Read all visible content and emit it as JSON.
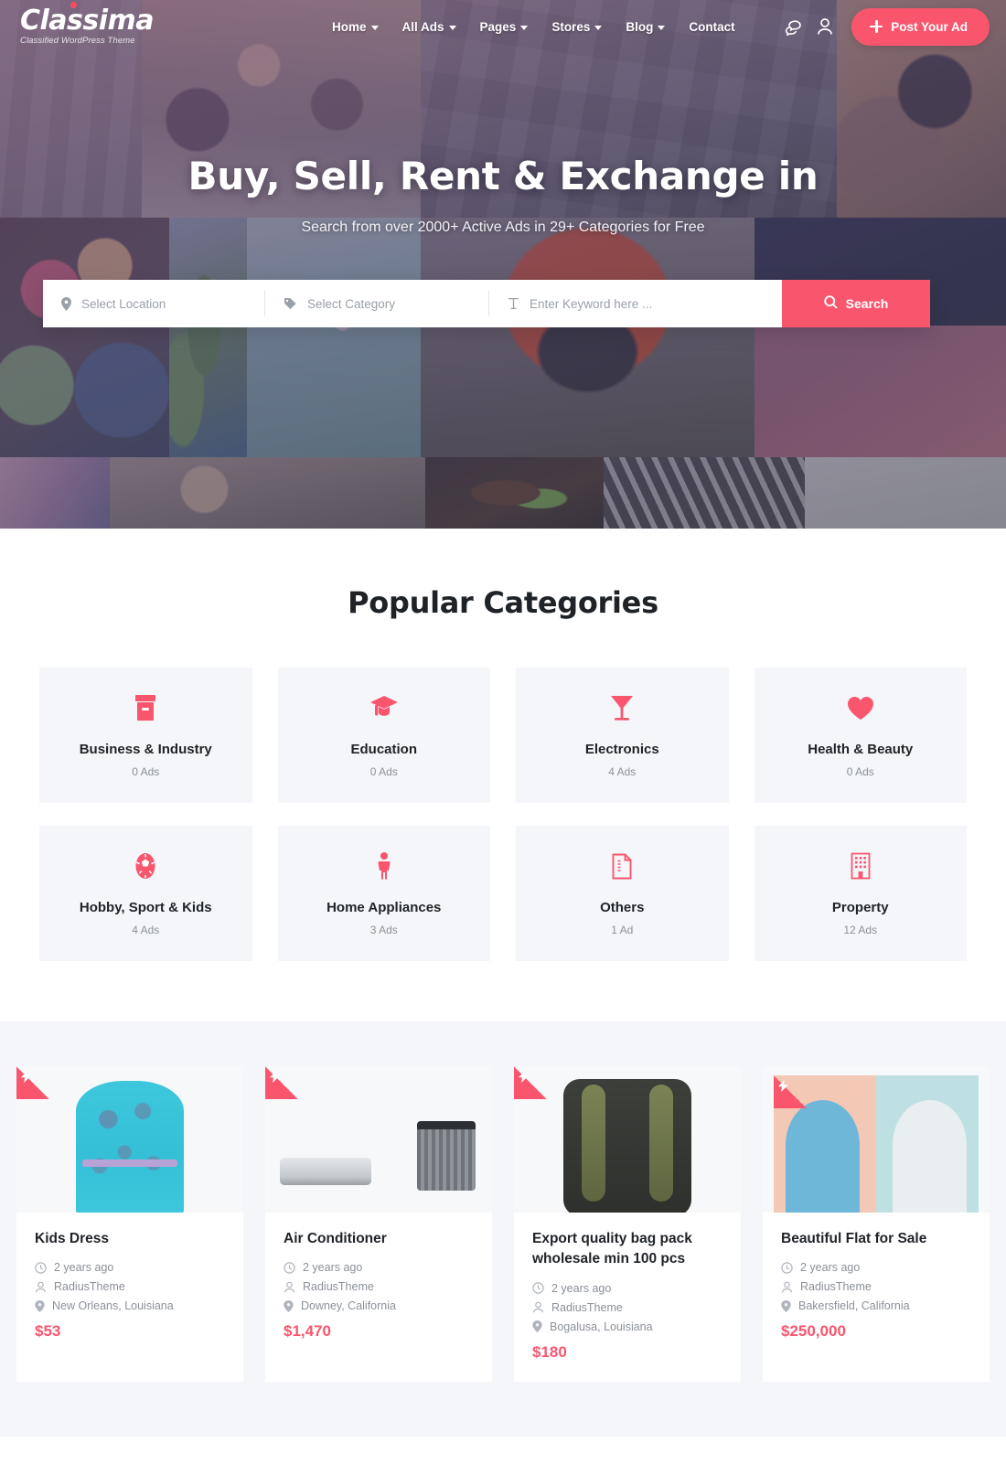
{
  "header": {
    "logo": {
      "name": "Classima",
      "tagline": "Classified WordPress Theme"
    },
    "nav": [
      {
        "label": "Home",
        "has_dropdown": true
      },
      {
        "label": "All Ads",
        "has_dropdown": true
      },
      {
        "label": "Pages",
        "has_dropdown": true
      },
      {
        "label": "Stores",
        "has_dropdown": true
      },
      {
        "label": "Blog",
        "has_dropdown": true
      },
      {
        "label": "Contact",
        "has_dropdown": false
      }
    ],
    "icons": {
      "chat": "chat-bubbles-icon",
      "account": "user-account-icon"
    },
    "post_ad_label": "Post Your Ad"
  },
  "hero": {
    "title": "Buy, Sell, Rent & Exchange in",
    "subtitle": "Search from over 2000+ Active Ads in 29+ Categories for Free"
  },
  "search": {
    "location_placeholder": "Select Location",
    "category_placeholder": "Select Category",
    "keyword_placeholder": "Enter Keyword here ...",
    "button_label": "Search"
  },
  "categories_section": {
    "title": "Popular Categories",
    "items": [
      {
        "name": "Business & Industry",
        "count": "0 Ads",
        "icon": "box-icon"
      },
      {
        "name": "Education",
        "count": "0 Ads",
        "icon": "graduation-cap-icon"
      },
      {
        "name": "Electronics",
        "count": "4 Ads",
        "icon": "cocktail-glass-icon"
      },
      {
        "name": "Health & Beauty",
        "count": "0 Ads",
        "icon": "heart-icon"
      },
      {
        "name": "Hobby, Sport & Kids",
        "count": "4 Ads",
        "icon": "football-icon"
      },
      {
        "name": "Home Appliances",
        "count": "3 Ads",
        "icon": "person-icon"
      },
      {
        "name": "Others",
        "count": "1 Ad",
        "icon": "document-icon"
      },
      {
        "name": "Property",
        "count": "12 Ads",
        "icon": "building-icon"
      }
    ]
  },
  "ads_section": {
    "items": [
      {
        "title": "Kids Dress",
        "time": "2 years ago",
        "author": "RadiusTheme",
        "location": "New Orleans, Louisiana",
        "price": "$53",
        "badge": "urgent-bolt-icon",
        "image": "kids-dress-photo"
      },
      {
        "title": "Air Conditioner",
        "time": "2 years ago",
        "author": "RadiusTheme",
        "location": "Downey, California",
        "price": "$1,470",
        "badge": "urgent-bolt-icon",
        "image": "air-conditioner-photo"
      },
      {
        "title": "Export quality bag pack wholesale min 100 pcs",
        "time": "2 years ago",
        "author": "RadiusTheme",
        "location": "Bogalusa, Louisiana",
        "price": "$180",
        "badge": "urgent-bolt-icon",
        "image": "backpack-photo"
      },
      {
        "title": "Beautiful Flat for Sale",
        "time": "2 years ago",
        "author": "RadiusTheme",
        "location": "Bakersfield, California",
        "price": "$250,000",
        "badge": "urgent-bolt-icon",
        "image": "flat-doors-photo"
      }
    ]
  },
  "colors": {
    "accent": "#f9566e",
    "card_bg": "#f4f6fa",
    "text_dark": "#1f2328",
    "text_muted": "#8b9099"
  }
}
